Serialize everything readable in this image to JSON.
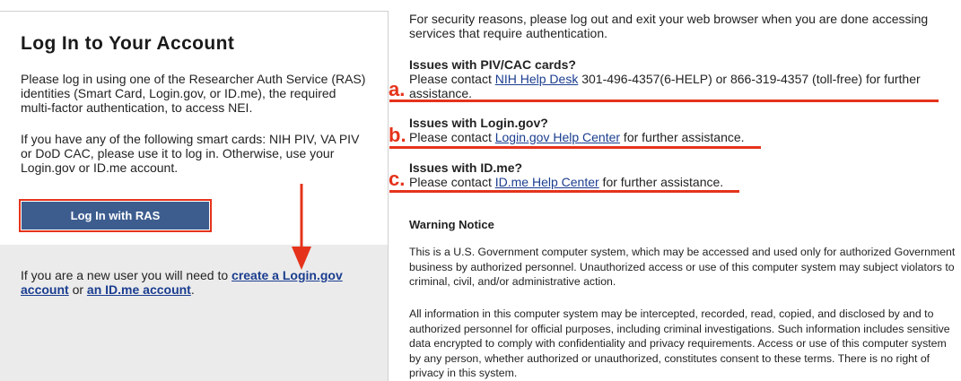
{
  "login": {
    "title": "Log In to Your Account",
    "intro": "Please log in using one of the Researcher Auth Service (RAS) identities (Smart Card, Login.gov, or ID.me), the required multi-factor authentication, to access NEI.",
    "smartcard": "If you have any of the following smart cards: NIH PIV, VA PIV or DoD CAC, please use it to log in. Otherwise, use your Login.gov or ID.me account.",
    "button_label": "Log In with RAS",
    "newuser_prefix": "If you are a new user you will need to ",
    "newuser_link1": "create a Login.gov account",
    "newuser_or": " or ",
    "newuser_link2": "an ID.me account",
    "newuser_suffix": "."
  },
  "info": {
    "security_note": "For security reasons, please log out and exit your web browser when you are done accessing services that require authentication.",
    "issues": [
      {
        "badge": "a.",
        "heading": "Issues with PIV/CAC cards?",
        "prefix": "Please contact ",
        "link": "NIH Help Desk",
        "suffix": " 301-496-4357(6-HELP) or 866-319-4357 (toll-free) for further assistance."
      },
      {
        "badge": "b.",
        "heading": "Issues with Login.gov?",
        "prefix": "Please contact ",
        "link": "Login.gov Help Center",
        "suffix": " for further assistance."
      },
      {
        "badge": "c.",
        "heading": "Issues with ID.me?",
        "prefix": "Please contact ",
        "link": "ID.me Help Center",
        "suffix": " for further assistance."
      }
    ],
    "warning_title": "Warning Notice",
    "warning_p1": "This is a U.S. Government computer system, which may be accessed and used only for authorized Government business by authorized personnel. Unauthorized access or use of this computer system may subject violators to criminal, civil, and/or administrative action.",
    "warning_p2": "All information in this computer system may be intercepted, recorded, read, copied, and disclosed by and to authorized personnel for official purposes, including criminal investigations. Such information includes sensitive data encrypted to comply with confidentiality and privacy requirements. Access or use of this computer system by any person, whether authorized or unauthorized, constitutes consent to these terms. There is no right of privacy in this system."
  },
  "colors": {
    "annotation": "#e5331b",
    "button_bg": "#3d5d8f",
    "link": "#1a3d8f",
    "newuser_bg": "#ebebeb"
  }
}
